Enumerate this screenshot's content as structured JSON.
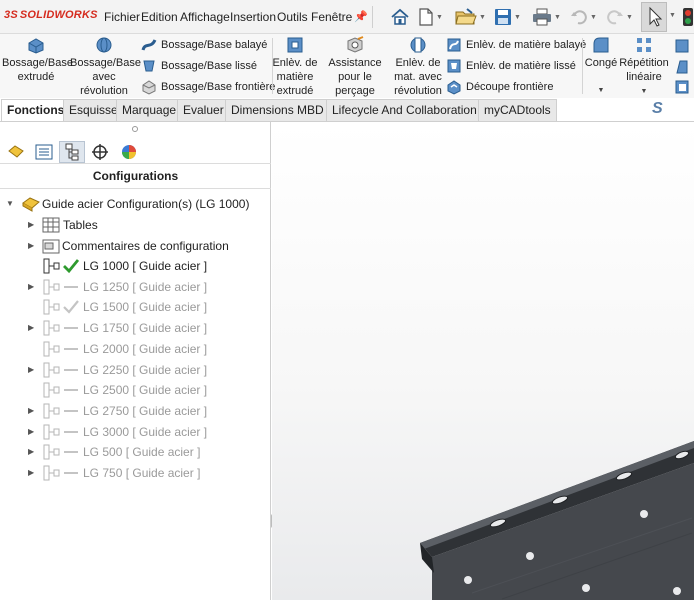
{
  "app": {
    "brand": "SOLIDWORKS"
  },
  "menu": {
    "items": [
      "Fichier",
      "Edition",
      "Affichage",
      "Insertion",
      "Outils",
      "Fenêtre"
    ]
  },
  "ribbon": {
    "bossage_extrude": "Bossage/Base extrudé",
    "bossage_revolution": "Bossage/Base avec révolution",
    "bossage_balaye": "Bossage/Base balayé",
    "bossage_lisse": "Bossage/Base lissé",
    "bossage_frontiere": "Bossage/Base frontière",
    "enlev_extrude": "Enlèv. de matière extrudé",
    "assistance_percage": "Assistance pour le perçage",
    "enlev_revolution": "Enlèv. de mat. avec révolution",
    "enlev_balaye": "Enlèv. de matière balayé",
    "enlev_lisse": "Enlèv. de matière lissé",
    "decoupe_frontiere": "Découpe frontière",
    "conge": "Congé",
    "repetition_lineaire": "Répétition linéaire"
  },
  "tabs": [
    {
      "label": "Fonctions",
      "active": true
    },
    {
      "label": "Esquisse",
      "active": false
    },
    {
      "label": "Marquage",
      "active": false
    },
    {
      "label": "Evaluer",
      "active": false
    },
    {
      "label": "Dimensions MBD",
      "active": false
    },
    {
      "label": "Lifecycle And Collaboration",
      "active": false
    },
    {
      "label": "myCADtools",
      "active": false
    }
  ],
  "panel": {
    "title": "Configurations",
    "root": "Guide acier Configuration(s)  (LG 1000)",
    "tables": "Tables",
    "comments": "Commentaires de configuration",
    "configs": [
      {
        "label": "LG 1000 [ Guide acier ]",
        "active": true,
        "expandable": false,
        "check": "green"
      },
      {
        "label": "LG 1250 [ Guide acier ]",
        "active": false,
        "expandable": true,
        "check": "none"
      },
      {
        "label": "LG 1500 [ Guide acier ]",
        "active": false,
        "expandable": false,
        "check": "grey"
      },
      {
        "label": "LG 1750 [ Guide acier ]",
        "active": false,
        "expandable": true,
        "check": "none"
      },
      {
        "label": "LG 2000 [ Guide acier ]",
        "active": false,
        "expandable": false,
        "check": "none"
      },
      {
        "label": "LG 2250 [ Guide acier ]",
        "active": false,
        "expandable": true,
        "check": "none"
      },
      {
        "label": "LG 2500 [ Guide acier ]",
        "active": false,
        "expandable": false,
        "check": "none"
      },
      {
        "label": "LG 2750 [ Guide acier ]",
        "active": false,
        "expandable": true,
        "check": "none"
      },
      {
        "label": "LG 3000 [ Guide acier ]",
        "active": false,
        "expandable": true,
        "check": "none"
      },
      {
        "label": "LG 500 [ Guide acier ]",
        "active": false,
        "expandable": true,
        "check": "none"
      },
      {
        "label": "LG 750 [ Guide acier ]",
        "active": false,
        "expandable": true,
        "check": "none"
      }
    ]
  },
  "colors": {
    "brand_red": "#d52b1e",
    "check_green": "#2e9a2e",
    "disabled_text": "#9a9a9a",
    "part_metal": "#4a4d52"
  }
}
